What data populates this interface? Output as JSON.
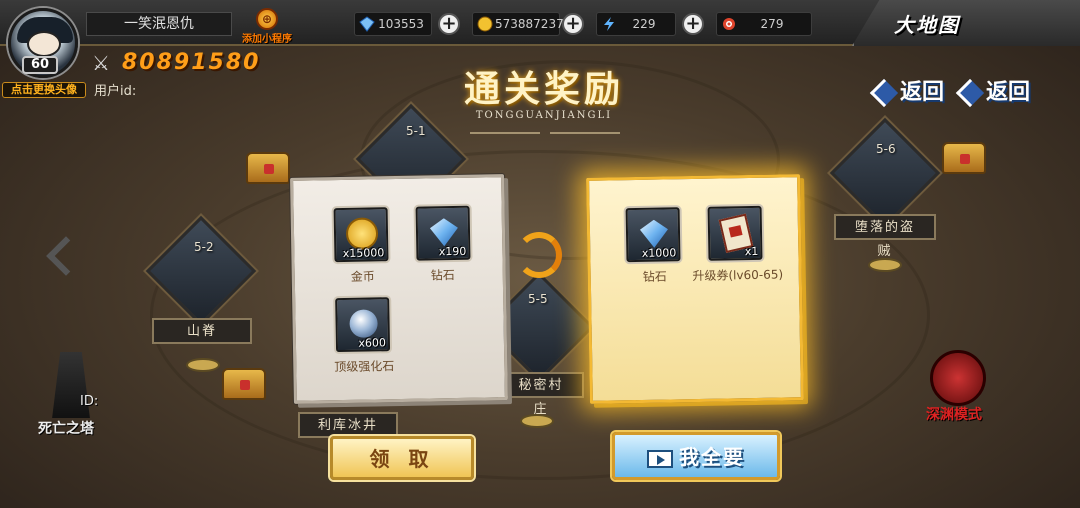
{
  "header": {
    "player_name": "一笑泯恩仇",
    "level": "60",
    "change_avatar": "点击更换头像",
    "mini_program": "添加小程序",
    "map_tab": "大地图"
  },
  "resources": [
    {
      "icon": "diamond-icon",
      "value": "103553"
    },
    {
      "icon": "gold-coin-icon",
      "value": "573887237"
    },
    {
      "icon": "energy-icon",
      "value": "229"
    },
    {
      "icon": "target-icon",
      "value": "279"
    }
  ],
  "player": {
    "power": "80891580",
    "uid_label": "用户id:"
  },
  "title": {
    "main": "通关奖励",
    "sub": "TONGGUANJIANGLI"
  },
  "back_buttons": [
    "返回",
    "返回"
  ],
  "map_nodes": [
    {
      "num": "5-1",
      "label": ""
    },
    {
      "num": "5-2",
      "label": "山脊"
    },
    {
      "num": "5-6",
      "label": "堕落的盗贼"
    },
    {
      "num": "5-5",
      "label": "秘密村庄"
    },
    {
      "num": "",
      "label": "利库冰井"
    }
  ],
  "left_panel": {
    "items": [
      {
        "icon": "gold-coin-icon",
        "qty": "x15000",
        "name": "金币"
      },
      {
        "icon": "diamond-icon",
        "qty": "x190",
        "name": "钻石"
      },
      {
        "icon": "enhance-stone-icon",
        "qty": "x600",
        "name": "顶级强化石"
      }
    ]
  },
  "right_panel": {
    "items": [
      {
        "icon": "diamond-icon",
        "qty": "x1000",
        "name": "钻石"
      },
      {
        "icon": "upgrade-ticket-icon",
        "qty": "x1",
        "name": "升级券(lv60-65)"
      }
    ]
  },
  "buttons": {
    "claim": "领 取",
    "want_all": "我全要"
  },
  "side": {
    "tower_label": "死亡之塔",
    "tower_id": "ID:",
    "abyss_label": "深渊模式"
  }
}
